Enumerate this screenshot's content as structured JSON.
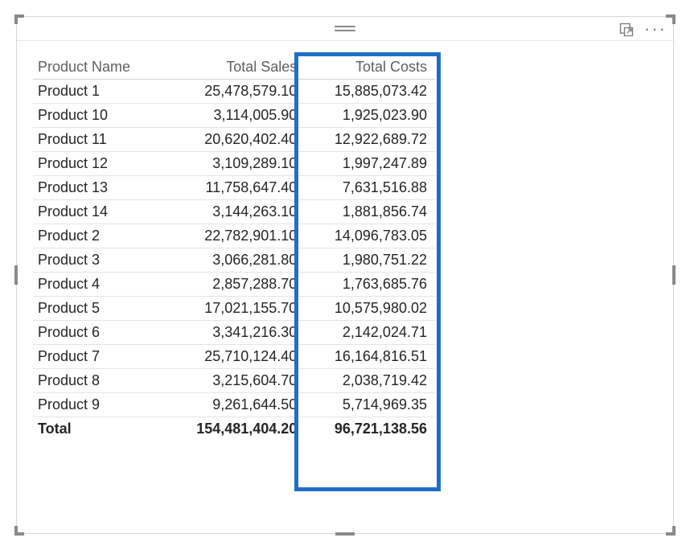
{
  "columns": {
    "c0": "Product Name",
    "c1": "Total Sales",
    "c2": "Total Costs"
  },
  "rows": [
    {
      "name": "Product 1",
      "sales": "25,478,579.10",
      "costs": "15,885,073.42"
    },
    {
      "name": "Product 10",
      "sales": "3,114,005.90",
      "costs": "1,925,023.90"
    },
    {
      "name": "Product 11",
      "sales": "20,620,402.40",
      "costs": "12,922,689.72"
    },
    {
      "name": "Product 12",
      "sales": "3,109,289.10",
      "costs": "1,997,247.89"
    },
    {
      "name": "Product 13",
      "sales": "11,758,647.40",
      "costs": "7,631,516.88"
    },
    {
      "name": "Product 14",
      "sales": "3,144,263.10",
      "costs": "1,881,856.74"
    },
    {
      "name": "Product 2",
      "sales": "22,782,901.10",
      "costs": "14,096,783.05"
    },
    {
      "name": "Product 3",
      "sales": "3,066,281.80",
      "costs": "1,980,751.22"
    },
    {
      "name": "Product 4",
      "sales": "2,857,288.70",
      "costs": "1,763,685.76"
    },
    {
      "name": "Product 5",
      "sales": "17,021,155.70",
      "costs": "10,575,980.02"
    },
    {
      "name": "Product 6",
      "sales": "3,341,216.30",
      "costs": "2,142,024.71"
    },
    {
      "name": "Product 7",
      "sales": "25,710,124.40",
      "costs": "16,164,816.51"
    },
    {
      "name": "Product 8",
      "sales": "3,215,604.70",
      "costs": "2,038,719.42"
    },
    {
      "name": "Product 9",
      "sales": "9,261,644.50",
      "costs": "5,714,969.35"
    }
  ],
  "total": {
    "label": "Total",
    "sales": "154,481,404.20",
    "costs": "96,721,138.56"
  },
  "highlight_column": 2
}
